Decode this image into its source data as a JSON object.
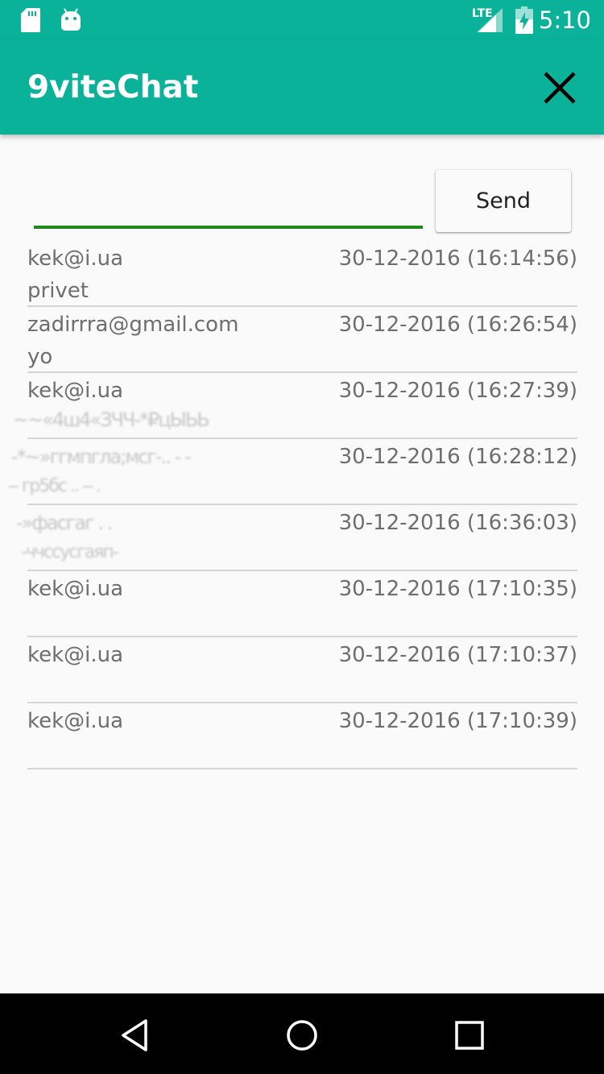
{
  "status_bar": {
    "time": "5:10",
    "network": "LTE",
    "icons": [
      "sd-card-icon",
      "android-icon",
      "lte-signal-icon",
      "battery-charging-icon"
    ]
  },
  "app_bar": {
    "title": "9viteChat",
    "close_icon": "close-icon"
  },
  "composer": {
    "input_value": "",
    "input_placeholder": "",
    "send_label": "Send"
  },
  "messages": [
    {
      "sender": "kek@i.ua",
      "text": "privet",
      "time": "30-12-2016 (16:14:56)"
    },
    {
      "sender": "zadirrra@gmail.com",
      "text": "yo",
      "time": "30-12-2016 (16:26:54)"
    },
    {
      "sender": "kek@i.ua",
      "text": "",
      "time": "30-12-2016 (16:27:39)"
    },
    {
      "sender": "",
      "text": "",
      "time": "30-12-2016 (16:28:12)"
    },
    {
      "sender": "",
      "text": "",
      "time": "30-12-2016 (16:36:03)"
    },
    {
      "sender": "kek@i.ua",
      "text": "",
      "time": "30-12-2016 (17:10:35)"
    },
    {
      "sender": "kek@i.ua",
      "text": "",
      "time": "30-12-2016 (17:10:37)"
    },
    {
      "sender": "kek@i.ua",
      "text": "",
      "time": "30-12-2016 (17:10:39)"
    }
  ],
  "nav_bar": {
    "icons": [
      "back-icon",
      "home-icon",
      "recents-icon"
    ]
  },
  "colors": {
    "primary": "#0bb29a",
    "input_underline": "#1e8a1e",
    "background": "#fafafa",
    "text_secondary": "#6e6e6e"
  }
}
